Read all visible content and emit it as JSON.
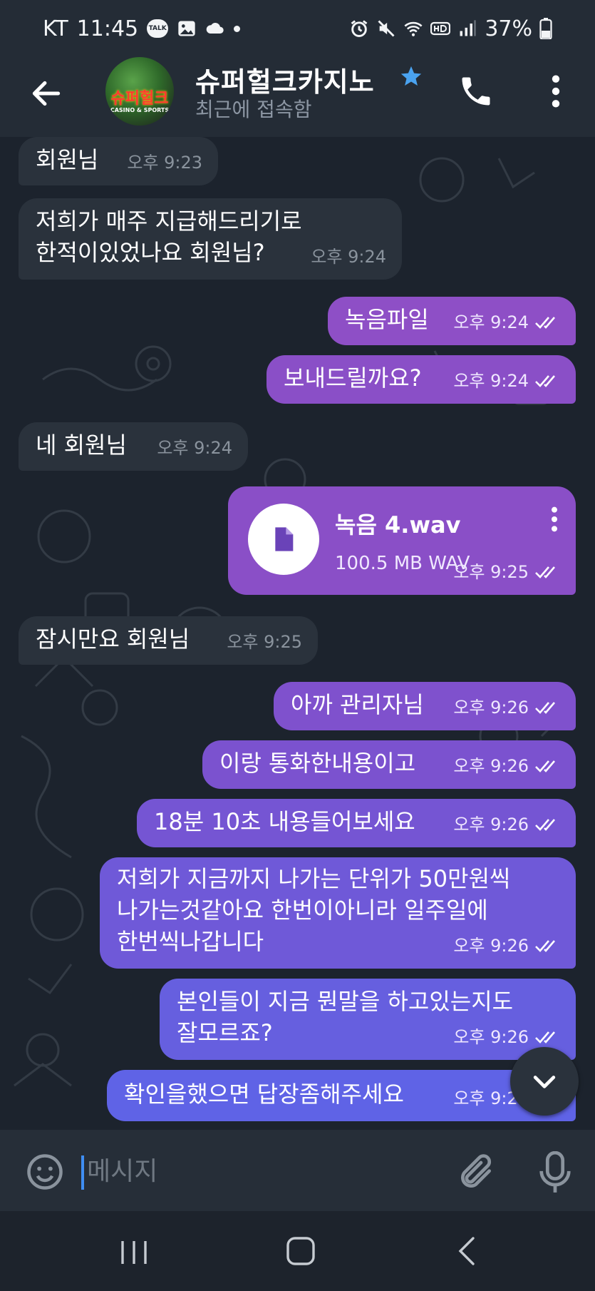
{
  "status_bar": {
    "carrier": "KT",
    "time": "11:45",
    "talk_badge": "TALK",
    "battery": "37%"
  },
  "header": {
    "title": "슈퍼헐크카지노",
    "status": "최근에 접속함",
    "avatar_text": "슈퍼헐크",
    "avatar_subtext": "CASINO & SPORTS"
  },
  "messages": [
    {
      "dir": "in",
      "text": "회원님",
      "time": "오후 9:23"
    },
    {
      "dir": "in",
      "text": "저희가 매주 지급해드리기로\n한적이있었나요 회원님?",
      "time": "오후 9:24"
    },
    {
      "dir": "out",
      "text": "녹음파일",
      "time": "오후 9:24"
    },
    {
      "dir": "out",
      "text": "보내드릴까요?",
      "time": "오후 9:24"
    },
    {
      "dir": "in",
      "text": "네 회원님",
      "time": "오후 9:24"
    },
    {
      "dir": "out",
      "type": "file",
      "file_name": "녹음  4.wav",
      "file_size": "100.5 MB WAV",
      "time": "오후 9:25"
    },
    {
      "dir": "in",
      "text": "잠시만요 회원님",
      "time": "오후 9:25"
    },
    {
      "dir": "out",
      "text": "아까 관리자님",
      "time": "오후 9:26"
    },
    {
      "dir": "out",
      "text": "이랑 통화한내용이고",
      "time": "오후 9:26"
    },
    {
      "dir": "out",
      "text": "18분 10초 내용들어보세요",
      "time": "오후 9:26"
    },
    {
      "dir": "out",
      "text": "저희가 지금까지 나가는 단위가 50만원씩\n나가는것같아요 한번이아니라 일주일에\n한번씩나갑니다",
      "time": "오후 9:26"
    },
    {
      "dir": "out",
      "text": "본인들이 지금 뭔말을 하고있는지도\n잘모르죠?",
      "time": "오후 9:26"
    },
    {
      "dir": "out",
      "text": "확인을했으면 답장좀해주세요",
      "time": "오후 9:26"
    }
  ],
  "input": {
    "placeholder": "메시지"
  },
  "colors": {
    "header_bg": "#242c36",
    "chat_bg": "#1c232d",
    "incoming_bubble": "#2a323c",
    "outgoing_top": "#8e4fc6",
    "outgoing_bottom": "#5f63e6",
    "accent_blue": "#3f8ef3"
  },
  "icons": [
    "back-arrow-icon",
    "star-icon",
    "phone-icon",
    "more-vert-icon",
    "file-icon",
    "double-check-icon",
    "chevron-down-icon",
    "emoji-icon",
    "attach-icon",
    "mic-icon"
  ]
}
